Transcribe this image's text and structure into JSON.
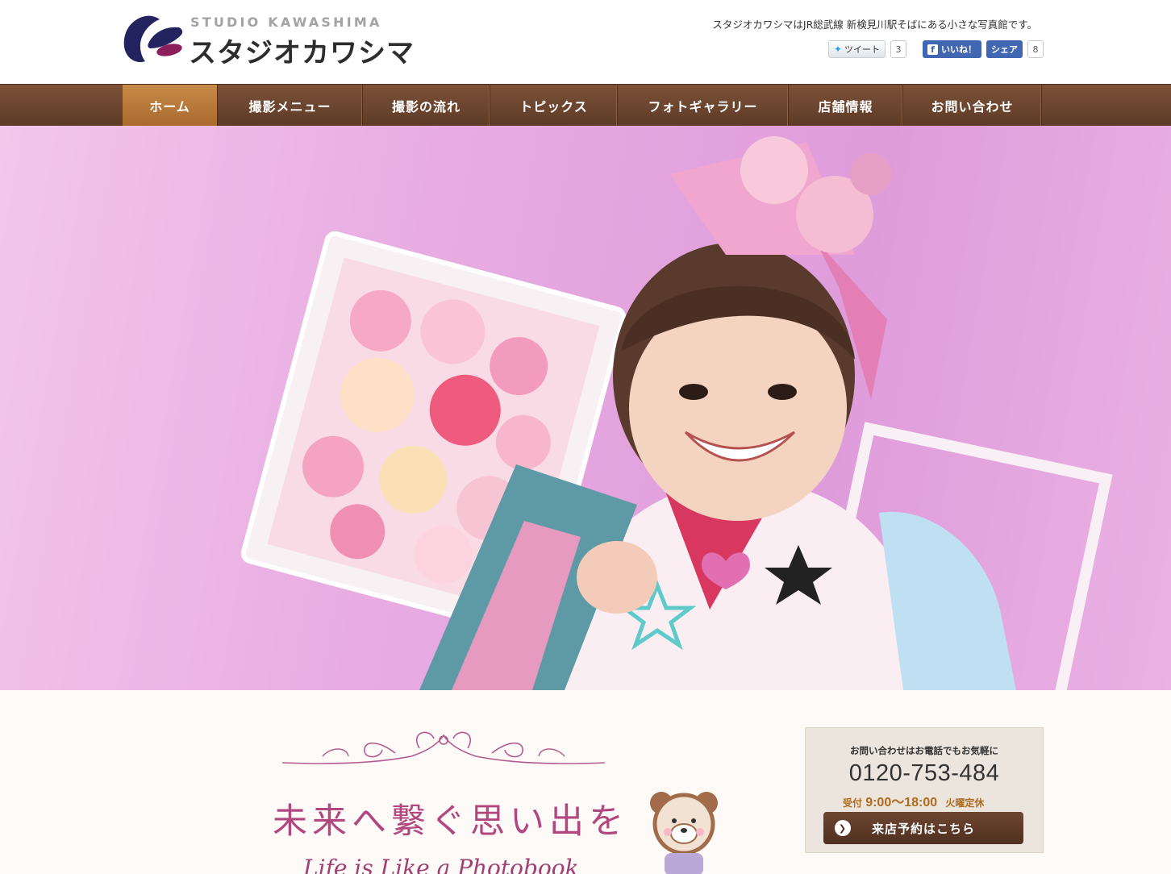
{
  "header": {
    "logo_en": "STUDIO KAWASHIMA",
    "logo_jp": "スタジオカワシマ",
    "tagline": "スタジオカワシマはJR総武線 新検見川駅そばにある小さな写真館です。",
    "social": {
      "tweet_label": "ツイート",
      "tweet_count": "3",
      "like_label": "いいね！",
      "share_label": "シェア",
      "share_count": "8"
    }
  },
  "nav": {
    "items": [
      {
        "label": "ホーム",
        "active": true
      },
      {
        "label": "撮影メニュー"
      },
      {
        "label": "撮影の流れ"
      },
      {
        "label": "トピックス"
      },
      {
        "label": "フォトギャラリー"
      },
      {
        "label": "店舗情報"
      },
      {
        "label": "お問い合わせ"
      }
    ]
  },
  "main": {
    "catch_jp": "未来へ繋ぐ思い出を",
    "catch_en": "Life is Like a Photobook"
  },
  "contact": {
    "heading": "お問い合わせはお電話でもお気軽に",
    "tel": "0120-753-484",
    "hours_label": "受付",
    "hours": "9:00～18:00",
    "closed": "火曜定休",
    "reserve_label": "来店予約はこちら"
  },
  "colors": {
    "nav_bg": "#6b4530",
    "nav_active": "#b87a3c",
    "accent_pink": "#b2477f",
    "hero_bg": "#e8ace2"
  }
}
